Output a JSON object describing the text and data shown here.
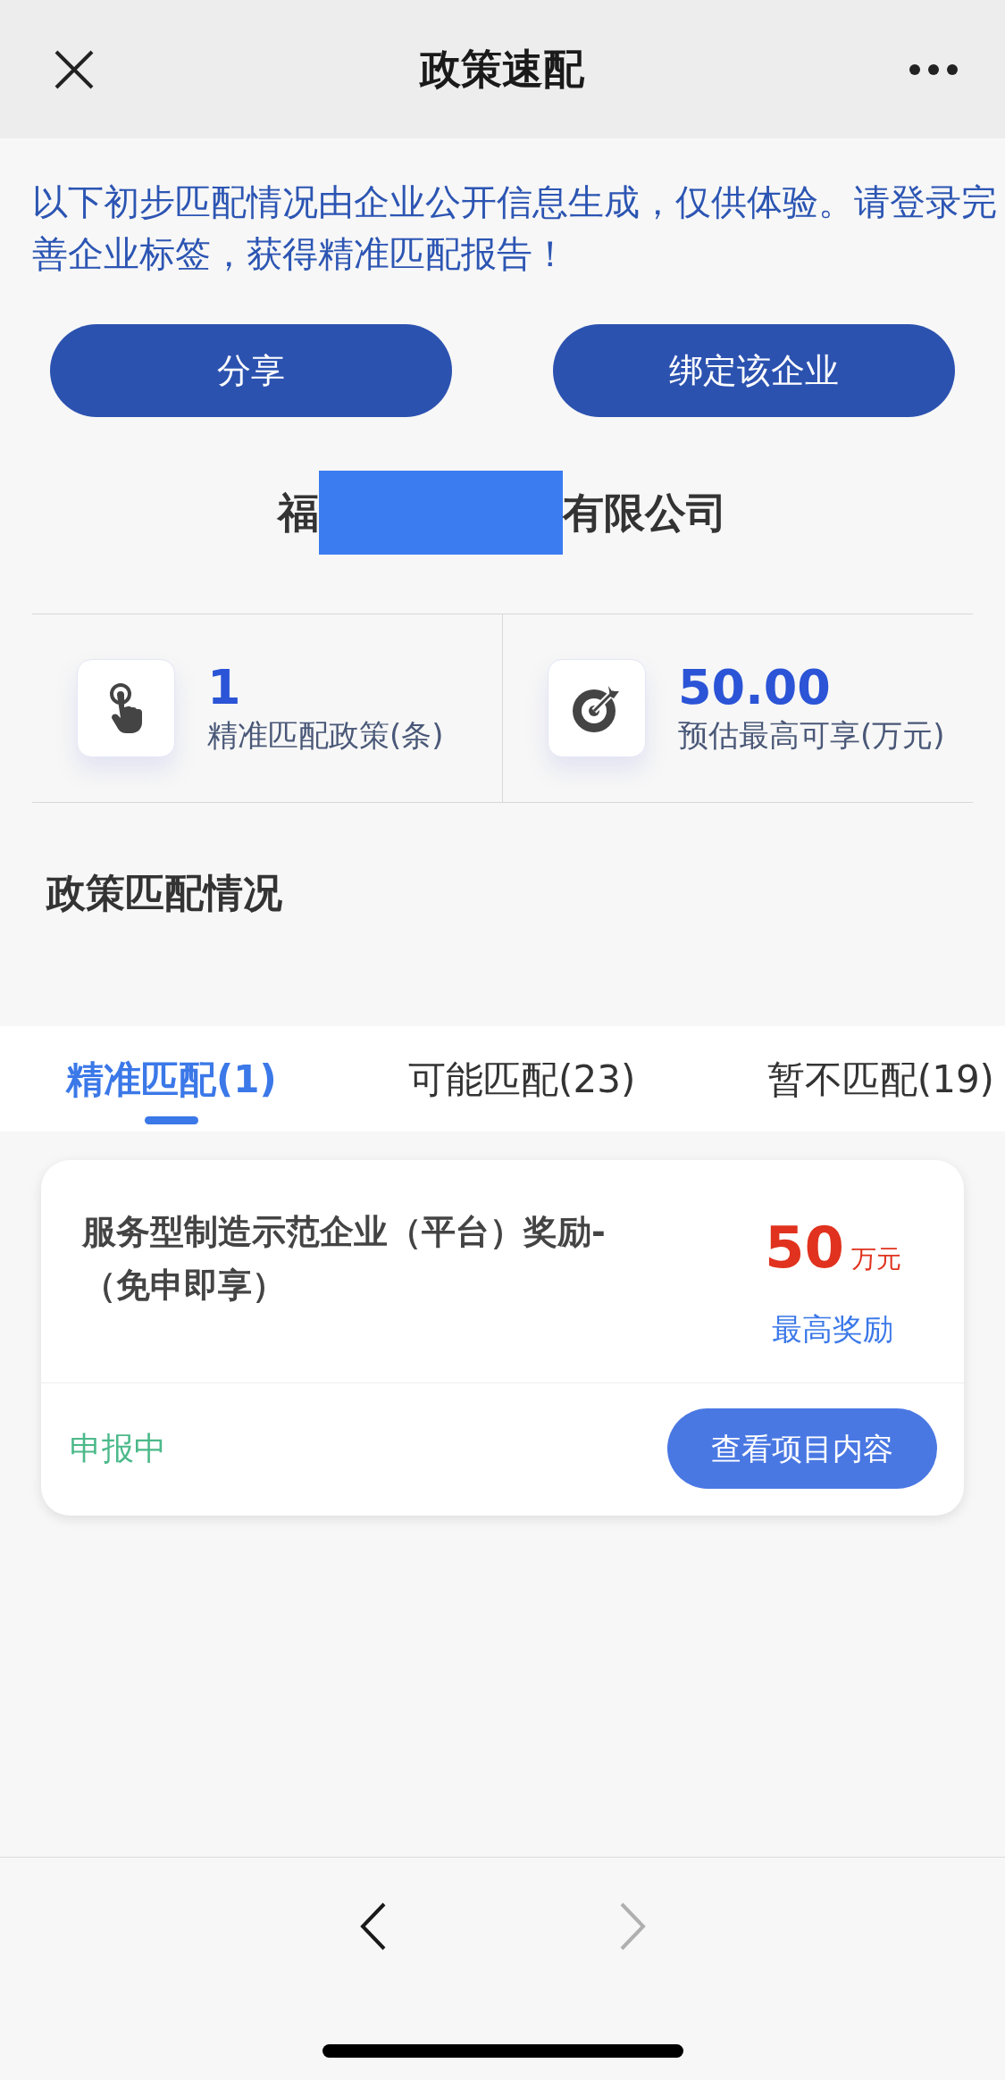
{
  "header": {
    "title": "政策速配"
  },
  "notice": "以下初步匹配情况由企业公开信息生成，仅供体验。请登录完善企业标签，获得精准匹配报告！",
  "actions": [
    "分享",
    "绑定该企业"
  ],
  "company": {
    "name_start": "福",
    "name_end": "有限公司",
    "redacted": true
  },
  "stats": [
    {
      "kind": "hand",
      "value": "1",
      "label": "精准匹配政策(条)"
    },
    {
      "kind": "target",
      "value": "50.00",
      "label": "预估最高可享(万元)"
    }
  ],
  "section_title": "政策匹配情况",
  "tabs": [
    {
      "label": "精准匹配(1)",
      "selected": true
    },
    {
      "label": "可能匹配(23)",
      "selected": false
    },
    {
      "label": "暂不匹配(19)",
      "selected": false
    }
  ],
  "policies": [
    {
      "title": "服务型制造示范企业（平台）奖励-（免申即享）",
      "amount": "50",
      "unit": "万元",
      "amount_label": "最高奖励",
      "status": "申报中",
      "button": "查看项目内容"
    }
  ],
  "nav": {
    "back_disabled": false,
    "forward_disabled": true
  }
}
